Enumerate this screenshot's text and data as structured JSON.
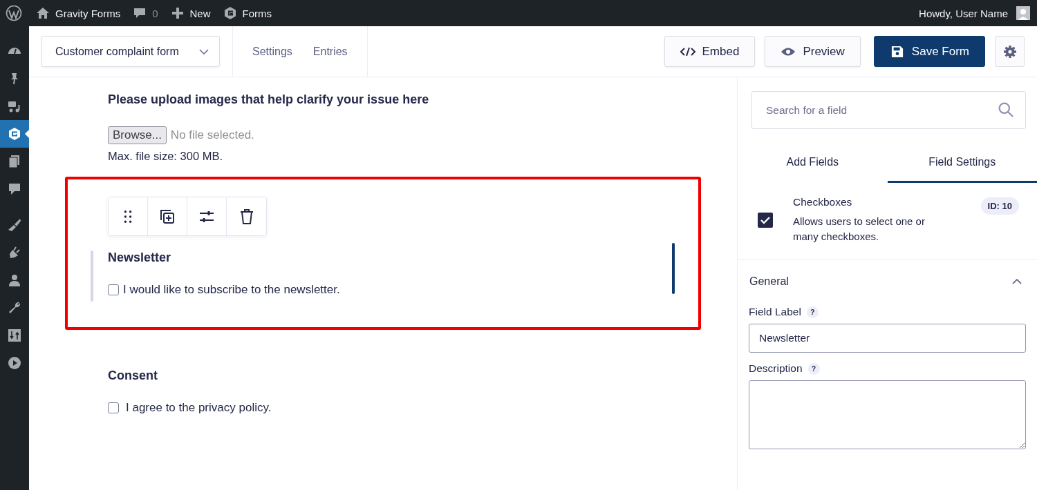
{
  "admin_bar": {
    "site": "Gravity Forms",
    "comments": "0",
    "new": "New",
    "forms": "Forms",
    "greeting": "Howdy, User Name"
  },
  "sidebar": {
    "items": [
      {
        "selected": false
      },
      {
        "selected": false
      },
      {
        "selected": false
      },
      {
        "selected": true
      },
      {
        "selected": false
      },
      {
        "selected": false
      },
      {
        "selected": false
      },
      {
        "selected": false
      },
      {
        "selected": false
      },
      {
        "selected": false
      },
      {
        "selected": false
      },
      {
        "selected": false
      }
    ]
  },
  "header": {
    "form_selector": "Customer complaint form",
    "links": [
      "Settings",
      "Entries"
    ],
    "embed": "Embed",
    "preview": "Preview",
    "save": "Save Form"
  },
  "fields": [
    {
      "kind": "fileupload",
      "label": "Please upload images that help clarify your issue here",
      "button": "Browse...",
      "status": "No file selected.",
      "note": "Max. file size: 300 MB.",
      "selected": false
    },
    {
      "kind": "checkbox",
      "label": "Newsletter",
      "option": "I would like to subscribe to the newsletter.",
      "checked": false,
      "selected": true
    },
    {
      "kind": "checkbox",
      "label": "Consent",
      "option": "I agree to the privacy policy.",
      "checked": false,
      "selected": false
    }
  ],
  "panel": {
    "search": {
      "placeholder": "Search for a field"
    },
    "tabs": [
      {
        "label": "Add Fields",
        "selected": false
      },
      {
        "label": "Field Settings",
        "selected": true
      }
    ],
    "field_type": {
      "name": "Checkboxes",
      "description": "Allows users to select one or many checkboxes.",
      "id": "ID: 10"
    },
    "section": {
      "title": "General",
      "expanded": true,
      "settings": [
        {
          "kind": "input",
          "label": "Field Label",
          "help": "?",
          "value": "Newsletter"
        },
        {
          "kind": "textarea",
          "label": "Description",
          "help": "?"
        }
      ]
    }
  }
}
